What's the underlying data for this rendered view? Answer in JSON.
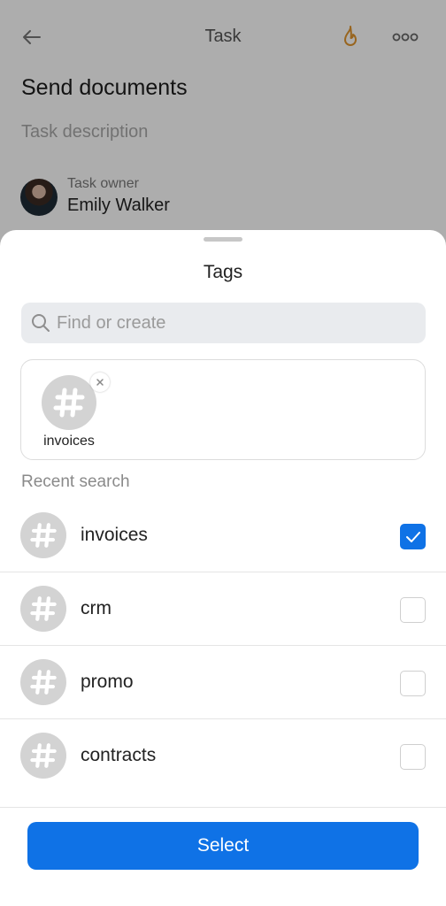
{
  "header": {
    "title": "Task",
    "back_icon": "back-arrow-icon",
    "fire_icon": "flame-icon",
    "more_icon": "more-dots-icon",
    "fire_color": "#E0962E"
  },
  "task": {
    "title": "Send documents",
    "description_placeholder": "Task description",
    "owner_label": "Task owner",
    "owner_name": "Emily Walker"
  },
  "sheet": {
    "title": "Tags",
    "search": {
      "placeholder": "Find or create",
      "value": ""
    },
    "selected": [
      {
        "label": "invoices",
        "icon": "hashtag-icon"
      }
    ],
    "recent_label": "Recent search",
    "tags": [
      {
        "name": "invoices",
        "checked": true
      },
      {
        "name": "crm",
        "checked": false
      },
      {
        "name": "promo",
        "checked": false
      },
      {
        "name": "contracts",
        "checked": false
      }
    ],
    "select_label": "Select",
    "accent_color": "#0F72E6"
  }
}
